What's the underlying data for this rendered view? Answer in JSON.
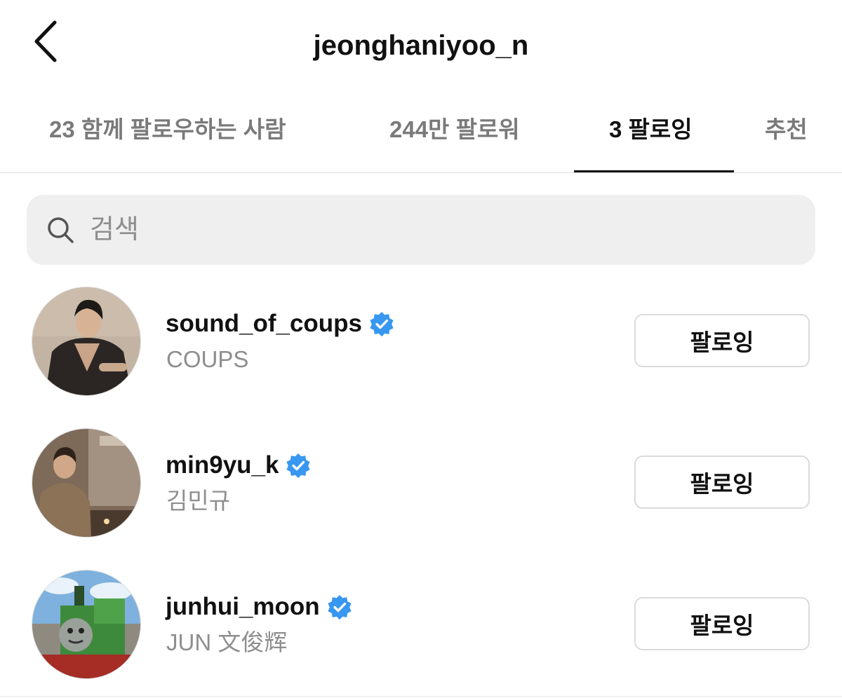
{
  "header": {
    "back_icon": "chevron-left-icon",
    "title": "jeonghaniyoo_n"
  },
  "tabs": [
    {
      "label": "23 함께 팔로우하는 사람",
      "active": false
    },
    {
      "label": "244만 팔로워",
      "active": false
    },
    {
      "label": "3 팔로잉",
      "active": true
    },
    {
      "label": "추천",
      "active": false
    }
  ],
  "search": {
    "icon": "search-icon",
    "placeholder": "검색"
  },
  "following": [
    {
      "username": "sound_of_coups",
      "full_name": "COUPS",
      "verified": true,
      "button_label": "팔로잉"
    },
    {
      "username": "min9yu_k",
      "full_name": "김민규",
      "verified": true,
      "button_label": "팔로잉"
    },
    {
      "username": "junhui_moon",
      "full_name": "JUN 文俊辉",
      "verified": true,
      "button_label": "팔로잉"
    }
  ],
  "colors": {
    "verified_badge": "#3897f0",
    "muted_text": "#8e8e8e",
    "search_bg": "#efefef"
  }
}
